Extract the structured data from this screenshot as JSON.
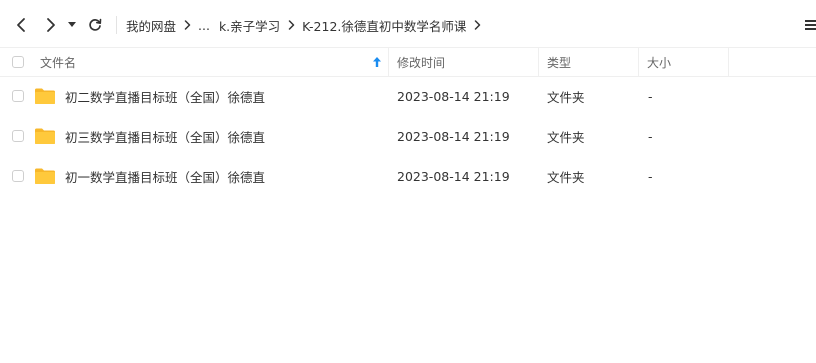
{
  "breadcrumb": {
    "root": "我的网盘",
    "ellipsis": "...",
    "level1": "k.亲子学习",
    "level2": "K-212.徐德直初中数学名师课"
  },
  "columns": {
    "name": "文件名",
    "modified": "修改时间",
    "type": "类型",
    "size": "大小"
  },
  "files": [
    {
      "name": "初二数学直播目标班（全国）徐德直",
      "modified": "2023-08-14 21:19",
      "type": "文件夹",
      "size": "-"
    },
    {
      "name": "初三数学直播目标班（全国）徐德直",
      "modified": "2023-08-14 21:19",
      "type": "文件夹",
      "size": "-"
    },
    {
      "name": "初一数学直播目标班（全国）徐德直",
      "modified": "2023-08-14 21:19",
      "type": "文件夹",
      "size": "-"
    }
  ],
  "colors": {
    "folder": "#ffc93c",
    "folder_tab": "#f7b72a",
    "sort_arrow": "#1a8cf0"
  }
}
